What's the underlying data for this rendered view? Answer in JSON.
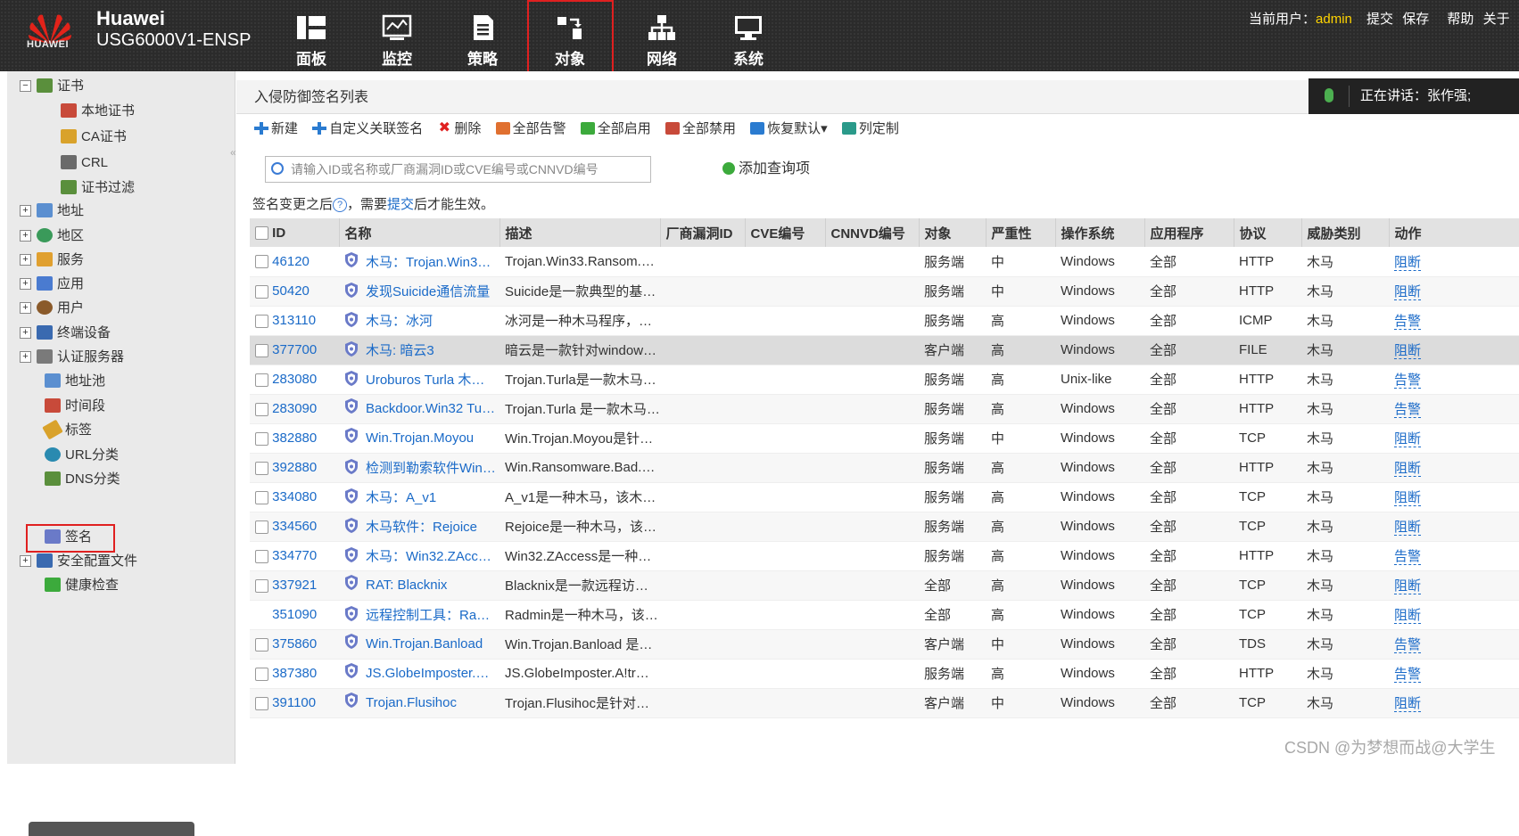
{
  "header": {
    "brand_small": "HUAWEI",
    "title_line1": "Huawei",
    "title_line2": "USG6000V1-ENSP",
    "nav": [
      {
        "label": "面板",
        "icon": "dashboard-icon"
      },
      {
        "label": "监控",
        "icon": "monitor-icon"
      },
      {
        "label": "策略",
        "icon": "policy-icon"
      },
      {
        "label": "对象",
        "icon": "object-icon"
      },
      {
        "label": "网络",
        "icon": "network-icon"
      },
      {
        "label": "系统",
        "icon": "system-icon"
      }
    ],
    "user_prefix": "当前用户：",
    "user": "admin",
    "links": [
      "提交",
      "保存",
      "帮助",
      "关于"
    ]
  },
  "voice": {
    "text": "正在讲话：张作强;"
  },
  "sidebar": {
    "items": [
      {
        "label": "证书"
      },
      {
        "label": "本地证书"
      },
      {
        "label": "CA证书"
      },
      {
        "label": "CRL"
      },
      {
        "label": "证书过滤"
      },
      {
        "label": "地址"
      },
      {
        "label": "地区"
      },
      {
        "label": "服务"
      },
      {
        "label": "应用"
      },
      {
        "label": "用户"
      },
      {
        "label": "终端设备"
      },
      {
        "label": "认证服务器"
      },
      {
        "label": "地址池"
      },
      {
        "label": "时间段"
      },
      {
        "label": "标签"
      },
      {
        "label": "URL分类"
      },
      {
        "label": "DNS分类"
      },
      {
        "label": "签名"
      },
      {
        "label": "安全配置文件"
      },
      {
        "label": "健康检查"
      }
    ]
  },
  "main": {
    "title": "入侵防御签名列表",
    "toolbar": [
      "新建",
      "自定义关联签名",
      "删除",
      "全部告警",
      "全部启用",
      "全部禁用",
      "恢复默认▾",
      "列定制"
    ],
    "search_placeholder": "请输入ID或名称或厂商漏洞ID或CVE编号或CNNVD编号",
    "add_query": "添加查询项",
    "notice_prefix": "签名变更之后",
    "notice_mid": "，需要",
    "notice_link": "提交",
    "notice_suffix": "后才能生效。",
    "columns": [
      "ID",
      "名称",
      "描述",
      "厂商漏洞ID",
      "CVE编号",
      "CNNVD编号",
      "对象",
      "严重性",
      "操作系统",
      "应用程序",
      "协议",
      "威胁类别",
      "动作"
    ],
    "rows": [
      {
        "id": "46120",
        "name": "木马：Trojan.Win3…",
        "desc": "Trojan.Win33.Ransom.…",
        "obj": "服务端",
        "sev": "中",
        "os": "Windows",
        "app": "全部",
        "proto": "HTTP",
        "cat": "木马",
        "action": "阻断"
      },
      {
        "id": "50420",
        "name": "发现Suicide通信流量",
        "desc": "Suicide是一款典型的基…",
        "obj": "服务端",
        "sev": "中",
        "os": "Windows",
        "app": "全部",
        "proto": "HTTP",
        "cat": "木马",
        "action": "阻断"
      },
      {
        "id": "313110",
        "name": "木马：冰河",
        "desc": "冰河是一种木马程序，…",
        "obj": "服务端",
        "sev": "高",
        "os": "Windows",
        "app": "全部",
        "proto": "ICMP",
        "cat": "木马",
        "action": "告警"
      },
      {
        "id": "377700",
        "name": "木马: 暗云3",
        "desc": "暗云是一款针对window…",
        "obj": "客户端",
        "sev": "高",
        "os": "Windows",
        "app": "全部",
        "proto": "FILE",
        "cat": "木马",
        "action": "阻断"
      },
      {
        "id": "283080",
        "name": "Uroburos Turla 木…",
        "desc": "Trojan.Turla是一款木马…",
        "obj": "服务端",
        "sev": "高",
        "os": "Unix-like",
        "app": "全部",
        "proto": "HTTP",
        "cat": "木马",
        "action": "告警"
      },
      {
        "id": "283090",
        "name": "Backdoor.Win32 Tu…",
        "desc": "Trojan.Turla 是一款木马…",
        "obj": "服务端",
        "sev": "高",
        "os": "Windows",
        "app": "全部",
        "proto": "HTTP",
        "cat": "木马",
        "action": "告警"
      },
      {
        "id": "382880",
        "name": "Win.Trojan.Moyou",
        "desc": "Win.Trojan.Moyou是针…",
        "obj": "服务端",
        "sev": "中",
        "os": "Windows",
        "app": "全部",
        "proto": "TCP",
        "cat": "木马",
        "action": "阻断"
      },
      {
        "id": "392880",
        "name": "检测到勒索软件Win…",
        "desc": "Win.Ransomware.Bad.…",
        "obj": "服务端",
        "sev": "高",
        "os": "Windows",
        "app": "全部",
        "proto": "HTTP",
        "cat": "木马",
        "action": "阻断"
      },
      {
        "id": "334080",
        "name": "木马：A_v1",
        "desc": "A_v1是一种木马，该木…",
        "obj": "服务端",
        "sev": "高",
        "os": "Windows",
        "app": "全部",
        "proto": "TCP",
        "cat": "木马",
        "action": "阻断"
      },
      {
        "id": "334560",
        "name": "木马软件：Rejoice",
        "desc": "Rejoice是一种木马，该…",
        "obj": "服务端",
        "sev": "高",
        "os": "Windows",
        "app": "全部",
        "proto": "TCP",
        "cat": "木马",
        "action": "阻断"
      },
      {
        "id": "334770",
        "name": "木马：Win32.ZAcc…",
        "desc": "Win32.ZAccess是一种…",
        "obj": "服务端",
        "sev": "高",
        "os": "Windows",
        "app": "全部",
        "proto": "HTTP",
        "cat": "木马",
        "action": "告警"
      },
      {
        "id": "337921",
        "name": "RAT: Blacknix",
        "desc": "Blacknix是一款远程访…",
        "obj": "全部",
        "sev": "高",
        "os": "Windows",
        "app": "全部",
        "proto": "TCP",
        "cat": "木马",
        "action": "阻断"
      },
      {
        "id": "351090",
        "name": "远程控制工具：Ra…",
        "desc": "Radmin是一种木马，该…",
        "obj": "全部",
        "sev": "高",
        "os": "Windows",
        "app": "全部",
        "proto": "TCP",
        "cat": "木马",
        "action": "阻断"
      },
      {
        "id": "375860",
        "name": "Win.Trojan.Banload",
        "desc": "Win.Trojan.Banload 是…",
        "obj": "客户端",
        "sev": "中",
        "os": "Windows",
        "app": "全部",
        "proto": "TDS",
        "cat": "木马",
        "action": "告警"
      },
      {
        "id": "387380",
        "name": "JS.GlobeImposter.…",
        "desc": "JS.GlobeImposter.A!tr…",
        "obj": "服务端",
        "sev": "高",
        "os": "Windows",
        "app": "全部",
        "proto": "HTTP",
        "cat": "木马",
        "action": "告警"
      },
      {
        "id": "391100",
        "name": "Trojan.Flusihoc",
        "desc": "Trojan.Flusihoc是针对…",
        "obj": "客户端",
        "sev": "中",
        "os": "Windows",
        "app": "全部",
        "proto": "TCP",
        "cat": "木马",
        "action": "阻断"
      }
    ]
  },
  "watermark": "CSDN @为梦想而战@大学生"
}
